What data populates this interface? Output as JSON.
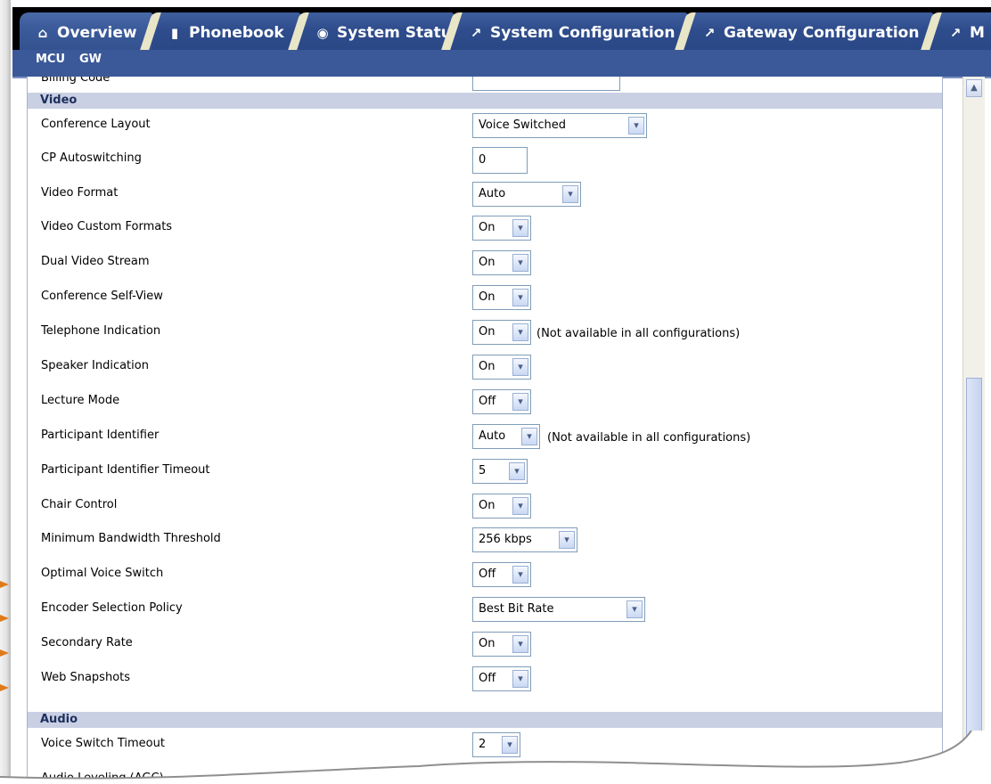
{
  "tabs": [
    {
      "label": "Overview",
      "icon": "home-icon"
    },
    {
      "label": "Phonebook",
      "icon": "phonebook-icon"
    },
    {
      "label": "System Status",
      "icon": "status-icon"
    },
    {
      "label": "System Configuration",
      "icon": "wrench-icon"
    },
    {
      "label": "Gateway Configuration",
      "icon": "wrench-icon"
    },
    {
      "label": "M",
      "icon": "wrench-icon"
    }
  ],
  "subnav": [
    "MCU",
    "GW"
  ],
  "partial_row": {
    "label": "Billing Code",
    "value": ""
  },
  "sections": {
    "video": "Video",
    "audio": "Audio"
  },
  "rows": [
    {
      "label": "Conference Layout",
      "value": "Voice Switched"
    },
    {
      "label": "CP Autoswitching",
      "value": "0"
    },
    {
      "label": "Video Format",
      "value": "Auto"
    },
    {
      "label": "Video Custom Formats",
      "value": "On"
    },
    {
      "label": "Dual Video Stream",
      "value": "On"
    },
    {
      "label": "Conference Self-View",
      "value": "On"
    },
    {
      "label": "Telephone Indication",
      "value": "On",
      "note": "(Not available in all configurations)"
    },
    {
      "label": "Speaker Indication",
      "value": "On"
    },
    {
      "label": "Lecture Mode",
      "value": "Off"
    },
    {
      "label": "Participant Identifier",
      "value": "Auto",
      "note": "(Not available in all configurations)"
    },
    {
      "label": "Participant Identifier Timeout",
      "value": "5"
    },
    {
      "label": "Chair Control",
      "value": "On"
    },
    {
      "label": "Minimum Bandwidth Threshold",
      "value": "256 kbps"
    },
    {
      "label": "Optimal Voice Switch",
      "value": "Off"
    },
    {
      "label": "Encoder Selection Policy",
      "value": "Best Bit Rate"
    },
    {
      "label": "Secondary Rate",
      "value": "On"
    },
    {
      "label": "Web Snapshots",
      "value": "Off"
    }
  ],
  "audio_rows": [
    {
      "label": "Voice Switch Timeout",
      "value": "2"
    },
    {
      "label": "Audio Leveling (AGC)",
      "value": ""
    }
  ],
  "colors": {
    "tab_blue": "#3b5998",
    "section_bg": "#c9d0e4",
    "highlight_arrow": "#e07b1a"
  }
}
